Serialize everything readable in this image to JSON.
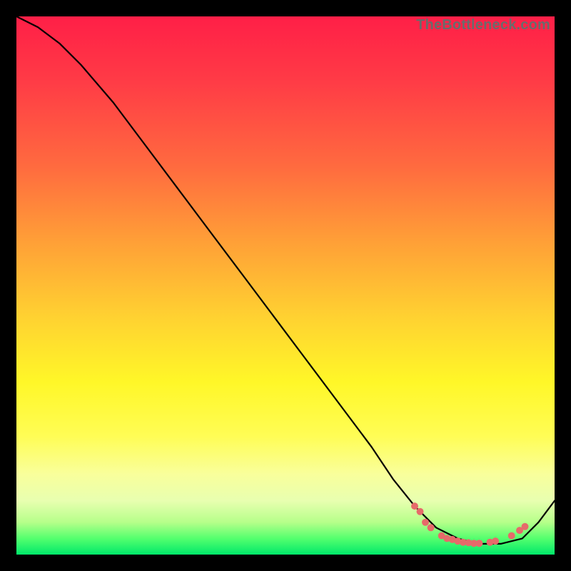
{
  "watermark": "TheBottleneck.com",
  "colors": {
    "gradient_top": "#ff1f47",
    "gradient_bottom": "#00e86a",
    "curve": "#000000",
    "marker": "#e66a6a",
    "frame": "#000000"
  },
  "chart_data": {
    "type": "line",
    "title": "",
    "xlabel": "",
    "ylabel": "",
    "xlim": [
      0,
      100
    ],
    "ylim": [
      0,
      100
    ],
    "grid": false,
    "legend": false,
    "series": [
      {
        "name": "curve",
        "x": [
          0,
          4,
          8,
          12,
          18,
          24,
          30,
          36,
          42,
          48,
          54,
          60,
          66,
          70,
          74,
          78,
          82,
          86,
          90,
          94,
          97,
          100
        ],
        "y": [
          100,
          98,
          95,
          91,
          84,
          76,
          68,
          60,
          52,
          44,
          36,
          28,
          20,
          14,
          9,
          5,
          3,
          2,
          2,
          3,
          6,
          10
        ]
      }
    ],
    "markers": [
      {
        "x": 74,
        "y": 9
      },
      {
        "x": 75,
        "y": 8
      },
      {
        "x": 76,
        "y": 6
      },
      {
        "x": 77,
        "y": 5
      },
      {
        "x": 79,
        "y": 3.5
      },
      {
        "x": 80,
        "y": 3
      },
      {
        "x": 81,
        "y": 2.8
      },
      {
        "x": 82,
        "y": 2.5
      },
      {
        "x": 83,
        "y": 2.3
      },
      {
        "x": 84,
        "y": 2.2
      },
      {
        "x": 85,
        "y": 2.1
      },
      {
        "x": 86,
        "y": 2.1
      },
      {
        "x": 88,
        "y": 2.3
      },
      {
        "x": 89,
        "y": 2.5
      },
      {
        "x": 92,
        "y": 3.5
      },
      {
        "x": 93.5,
        "y": 4.5
      },
      {
        "x": 94.5,
        "y": 5.2
      }
    ]
  }
}
